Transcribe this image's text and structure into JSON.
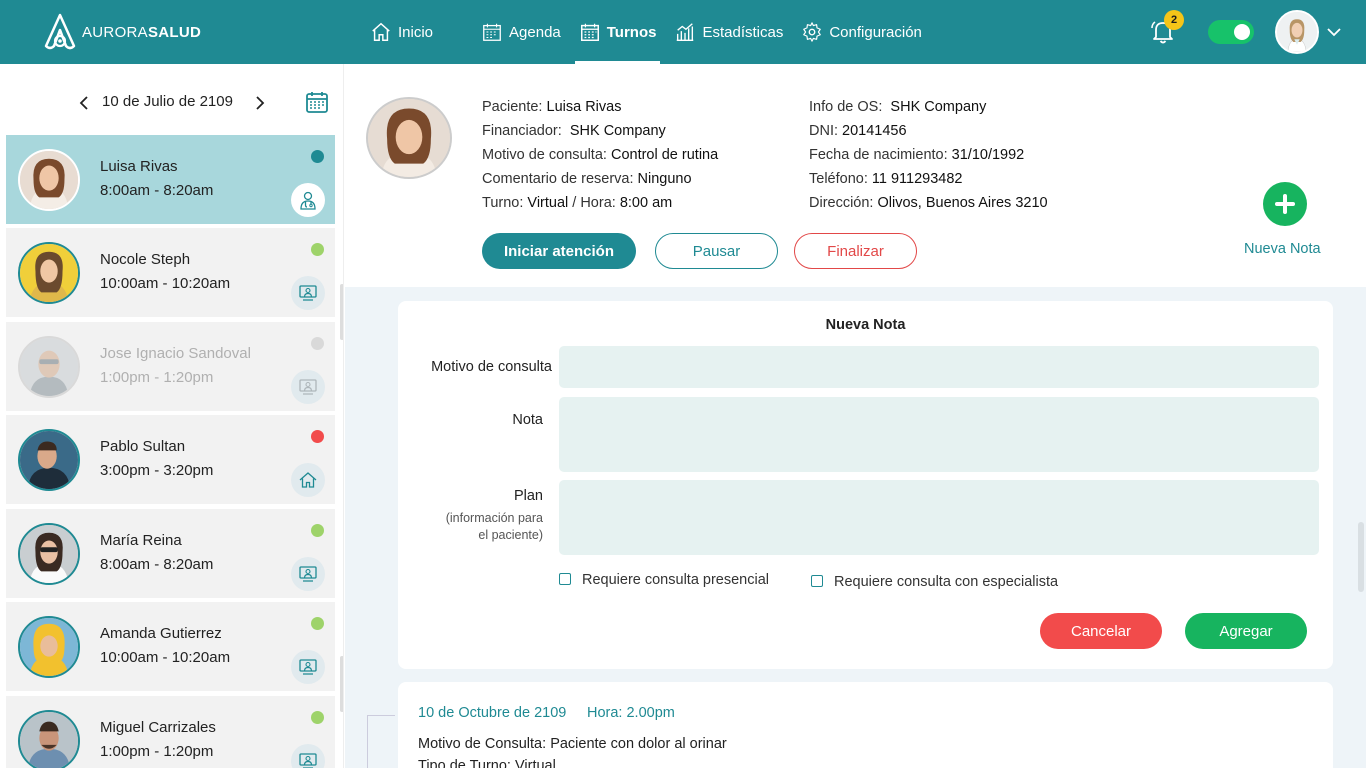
{
  "brand": {
    "part1": "AURORA",
    "part2": "SALUD"
  },
  "nav": {
    "items": [
      {
        "label": "Inicio",
        "icon": "home-icon"
      },
      {
        "label": "Agenda",
        "icon": "calendar-icon"
      },
      {
        "label": "Turnos",
        "icon": "calendar-grid-icon",
        "active": true
      },
      {
        "label": "Estadísticas",
        "icon": "bar-chart-icon"
      },
      {
        "label": "Configuración",
        "icon": "gear-icon"
      }
    ],
    "notifications": "2"
  },
  "sidebar": {
    "date": "10 de Julio de 2109",
    "appointments": [
      {
        "name": "Luisa Rivas",
        "time": "8:00am - 8:20am",
        "status_color": "#1f8a93",
        "type": "clinic",
        "selected": true
      },
      {
        "name": "Nocole Steph",
        "time": "10:00am - 10:20am",
        "status_color": "#9ed36a",
        "type": "virtual"
      },
      {
        "name": "Jose Ignacio Sandoval",
        "time": "1:00pm - 1:20pm",
        "status_color": "#d9d9d9",
        "type": "virtual",
        "disabled": true
      },
      {
        "name": "Pablo Sultan",
        "time": "3:00pm - 3:20pm",
        "status_color": "#f24b4b",
        "type": "home"
      },
      {
        "name": "María Reina",
        "time": "8:00am - 8:20am",
        "status_color": "#9ed36a",
        "type": "virtual"
      },
      {
        "name": "Amanda Gutierrez",
        "time": "10:00am - 10:20am",
        "status_color": "#9ed36a",
        "type": "virtual"
      },
      {
        "name": "Miguel Carrizales",
        "time": "1:00pm - 1:20pm",
        "status_color": "#9ed36a",
        "type": "virtual"
      }
    ]
  },
  "patient": {
    "left": [
      {
        "label": "Paciente:",
        "value": "Luisa Rivas"
      },
      {
        "label": "Financiador:",
        "value": "SHK Company"
      },
      {
        "label": "Motivo de consulta:",
        "value": "Control de rutina"
      },
      {
        "label": "Comentario de reserva:",
        "value": "Ninguno"
      }
    ],
    "turno_label": "Turno:",
    "turno_value": "Virtual",
    "hora_label": "/ Hora:",
    "hora_value": "8:00 am",
    "right": [
      {
        "label": "Info de OS:",
        "value": "SHK Company"
      },
      {
        "label": "DNI:",
        "value": "20141456"
      },
      {
        "label": "Fecha de nacimiento:",
        "value": "31/10/1992"
      },
      {
        "label": "Teléfono:",
        "value": "11 911293482"
      },
      {
        "label": "Dirección:",
        "value": "Olivos, Buenos Aires 3210"
      }
    ],
    "actions": {
      "start": "Iniciar atención",
      "pause": "Pausar",
      "end": "Finalizar"
    },
    "add_note": "Nueva Nota"
  },
  "note_form": {
    "title": "Nueva Nota",
    "motivo_label": "Motivo de consulta",
    "nota_label": "Nota",
    "plan_label": "Plan",
    "plan_sub1": "(información para",
    "plan_sub2": "el paciente)",
    "check1": "Requiere consulta presencial",
    "check2": "Requiere consulta con especialista",
    "cancel": "Cancelar",
    "add": "Agregar"
  },
  "history": {
    "date": "10 de Octubre de 2109",
    "time": "Hora: 2.00pm",
    "motivo_label": "Motivo de Consulta:",
    "motivo_value": "Paciente con dolor al orinar",
    "tipo_label": "Tipo de Turno:",
    "tipo_value": "Virtual"
  }
}
